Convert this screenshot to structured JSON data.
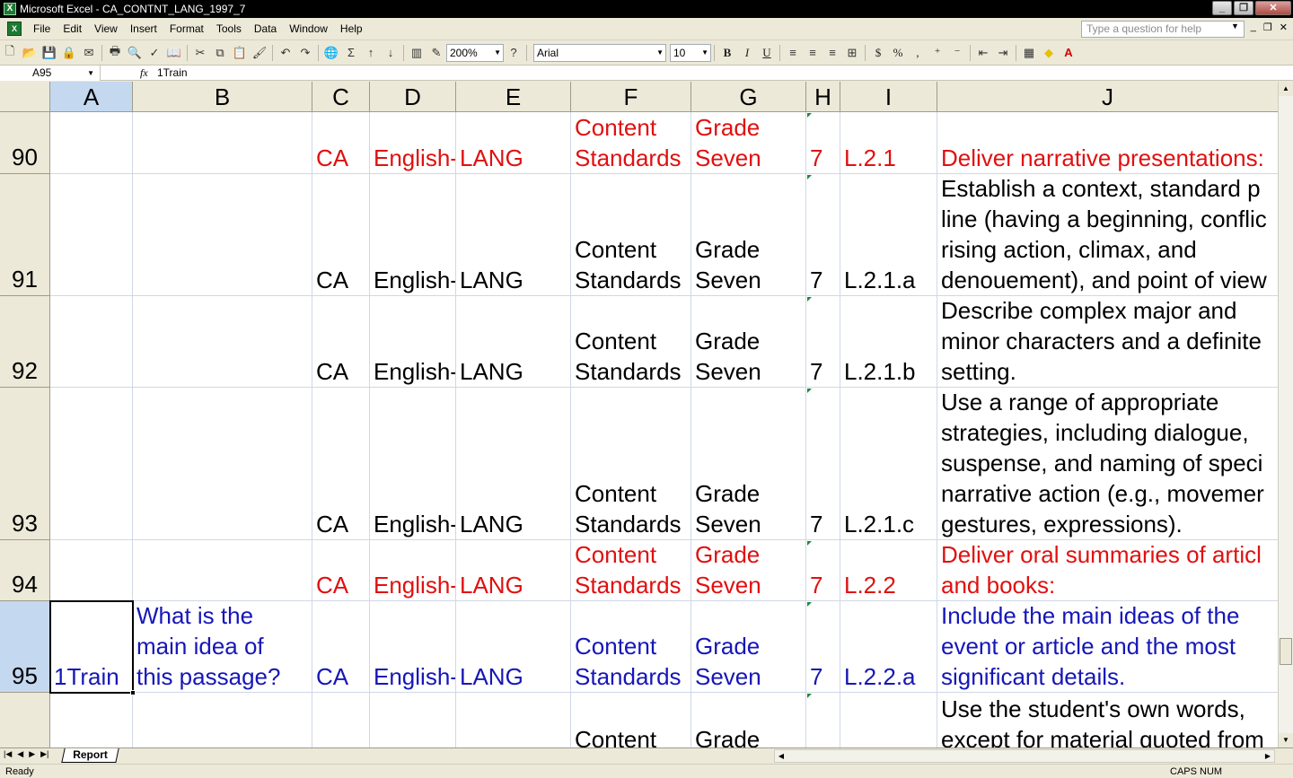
{
  "window": {
    "title": "Microsoft Excel - CA_CONTNT_LANG_1997_7",
    "app_icon": "excel-icon"
  },
  "menu": {
    "items": [
      "File",
      "Edit",
      "View",
      "Insert",
      "Format",
      "Tools",
      "Data",
      "Window",
      "Help"
    ],
    "help_placeholder": "Type a question for help"
  },
  "toolbar": {
    "zoom": "200%",
    "font_name": "Arial",
    "font_size": "10",
    "bold": "B",
    "italic": "I",
    "underline": "U",
    "currency": "$",
    "percent": "%",
    "comma": ","
  },
  "formula_bar": {
    "name_box": "A95",
    "fx": "fx",
    "content": "1Train"
  },
  "columns": [
    "A",
    "B",
    "C",
    "D",
    "E",
    "F",
    "G",
    "H",
    "I",
    "J"
  ],
  "selected_column": "A",
  "rows": [
    {
      "num": "90",
      "color": "red",
      "A": "",
      "B": "",
      "C": "CA",
      "D": "English-",
      "E": "LANG",
      "F": "Content\nStandards",
      "G": "Grade\nSeven",
      "H": "7",
      "I": "L.2.1",
      "J": "Deliver narrative presentations:"
    },
    {
      "num": "91",
      "color": "black",
      "A": "",
      "B": "",
      "C": "CA",
      "D": "English-",
      "E": "LANG",
      "F": "Content\nStandards",
      "G": "Grade\nSeven",
      "H": "7",
      "I": "L.2.1.a",
      "J": "Establish a context, standard p\nline (having a beginning, conflic\nrising action, climax, and\ndenouement), and point of view"
    },
    {
      "num": "92",
      "color": "black",
      "A": "",
      "B": "",
      "C": "CA",
      "D": "English-",
      "E": "LANG",
      "F": "Content\nStandards",
      "G": "Grade\nSeven",
      "H": "7",
      "I": "L.2.1.b",
      "J": "Describe complex major and\nminor characters and a definite\nsetting."
    },
    {
      "num": "93",
      "color": "black",
      "A": "",
      "B": "",
      "C": "CA",
      "D": "English-",
      "E": "LANG",
      "F": "Content\nStandards",
      "G": "Grade\nSeven",
      "H": "7",
      "I": "L.2.1.c",
      "J": "Use a range of appropriate\nstrategies, including dialogue,\nsuspense, and naming of speci\nnarrative action (e.g., movemer\ngestures, expressions)."
    },
    {
      "num": "94",
      "color": "red",
      "A": "",
      "B": "",
      "C": "CA",
      "D": "English-",
      "E": "LANG",
      "F": "Content\nStandards",
      "G": "Grade\nSeven",
      "H": "7",
      "I": "L.2.2",
      "J": "Deliver oral summaries of articl\nand books:"
    },
    {
      "num": "95",
      "color": "blue",
      "A": "1Train",
      "B": "What is the\nmain idea of\nthis passage?",
      "C": "CA",
      "D": "English-",
      "E": "LANG",
      "F": "Content\nStandards",
      "G": "Grade\nSeven",
      "H": "7",
      "I": "L.2.2.a",
      "J": "Include the main ideas of the\nevent or article and the most\nsignificant details."
    },
    {
      "num": "",
      "color": "black",
      "A": "",
      "B": "",
      "C": "",
      "D": "",
      "E": "",
      "F": "Content",
      "G": "Grade",
      "H": "",
      "I": "",
      "J": "Use the student's own words,\nexcept for material quoted from"
    }
  ],
  "sheet_tabs": [
    "Report"
  ],
  "status": {
    "left": "Ready",
    "right": "CAPS NUM"
  }
}
